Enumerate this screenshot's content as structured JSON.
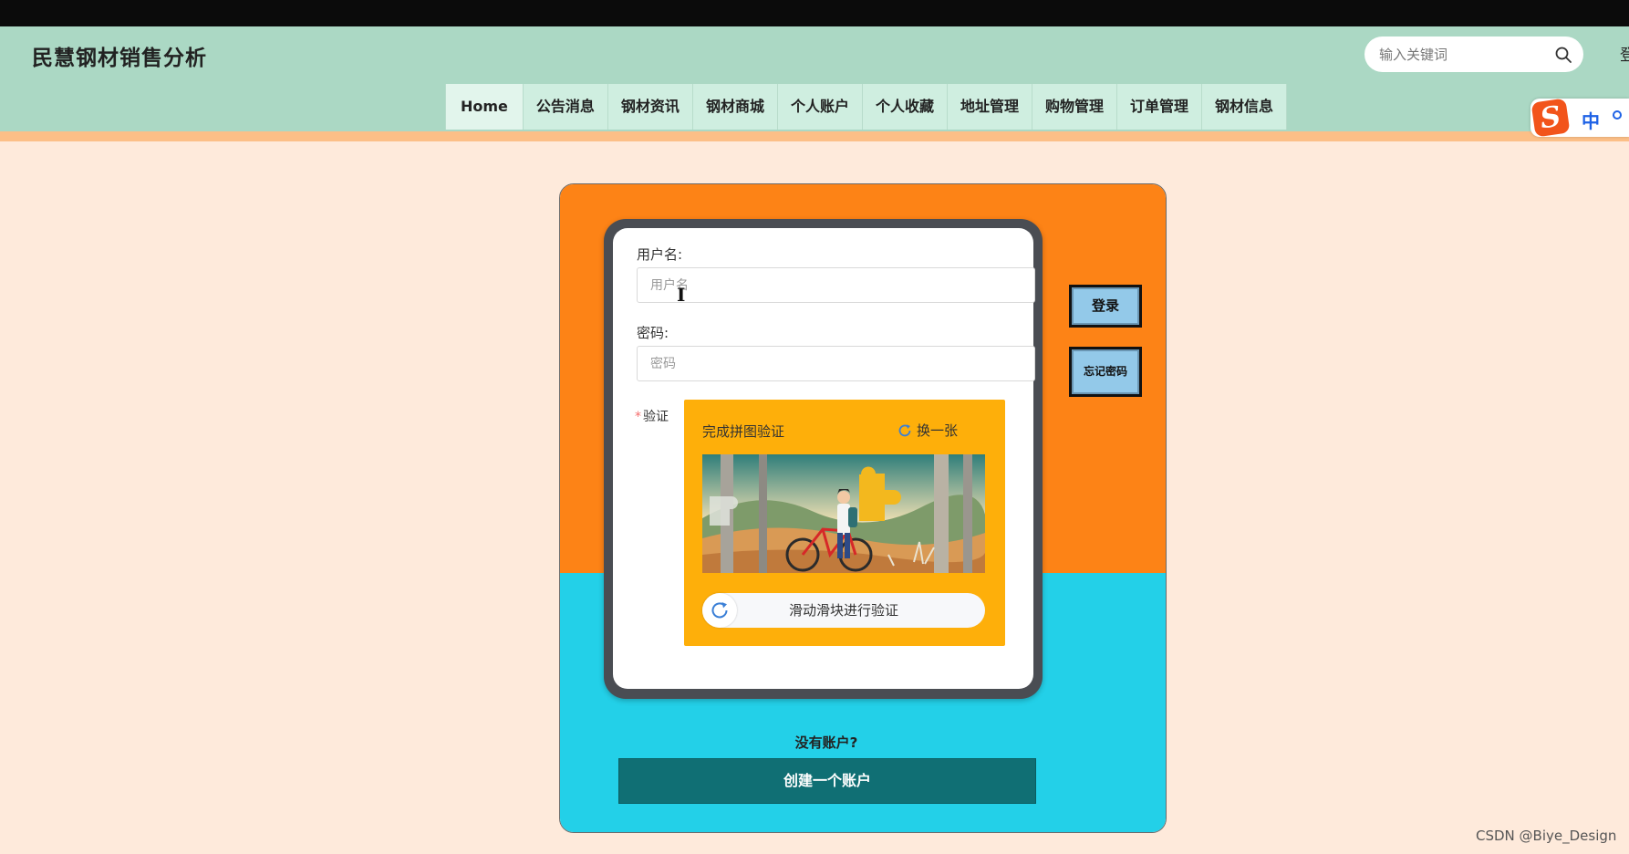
{
  "header": {
    "site_title": "民慧钢材销售分析",
    "search_placeholder": "输入关键词",
    "edge_text": "登"
  },
  "nav": {
    "items": [
      "Home",
      "公告消息",
      "钢材资讯",
      "钢材商城",
      "个人账户",
      "个人收藏",
      "地址管理",
      "购物管理",
      "订单管理",
      "钢材信息"
    ]
  },
  "ime": {
    "label": "中"
  },
  "login_form": {
    "username_label": "用户名:",
    "username_placeholder": "用户名",
    "password_label": "密码:",
    "password_placeholder": "密码",
    "verify_required_mark": "*",
    "verify_label": "验证",
    "captcha_title": "完成拼图验证",
    "captcha_refresh": "换一张",
    "slider_text": "滑动滑块进行验证"
  },
  "side_buttons": {
    "login": "登录",
    "forgot": "忘记密码"
  },
  "register": {
    "prompt": "没有账户?",
    "button": "创建一个账户"
  },
  "watermark": "CSDN @Biye_Design",
  "colors": {
    "header_bg": "#abd8c4",
    "page_bg": "#feeadb",
    "panel_top": "#fd8316",
    "panel_bottom": "#23d0e8",
    "captcha_bg": "#feaf0a",
    "create_button": "#106f74",
    "side_button": "#93c9e9"
  }
}
